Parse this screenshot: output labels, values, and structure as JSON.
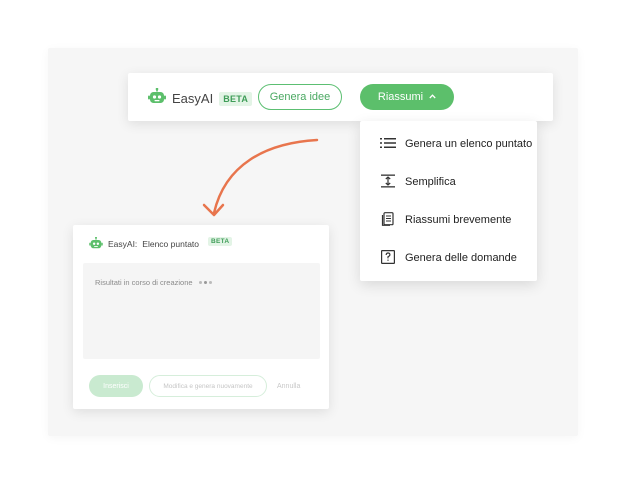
{
  "toolbar": {
    "brand_name": "EasyAI",
    "beta_label": "BETA",
    "generate_ideas_label": "Genera idee",
    "summarize_label": "Riassumi"
  },
  "menu": {
    "items": [
      {
        "label": "Genera un elenco puntato",
        "icon": "bullet-list-icon"
      },
      {
        "label": "Semplifica",
        "icon": "compress-icon"
      },
      {
        "label": "Riassumi brevemente",
        "icon": "document-icon"
      },
      {
        "label": "Genera delle domande",
        "icon": "question-box-icon"
      }
    ]
  },
  "panel": {
    "brand_name": "EasyAI:",
    "mode_label": "Elenco puntato",
    "beta_label": "BETA",
    "status_text": "Risultati in corso di creazione",
    "insert_label": "Inserisci",
    "regenerate_label": "Modifica e genera nuovamente",
    "cancel_label": "Annulla"
  },
  "colors": {
    "accent_green": "#5cbf6b",
    "arrow_orange": "#e8754d",
    "beta_bg": "#e3f4e6",
    "beta_text": "#3f9d58"
  }
}
